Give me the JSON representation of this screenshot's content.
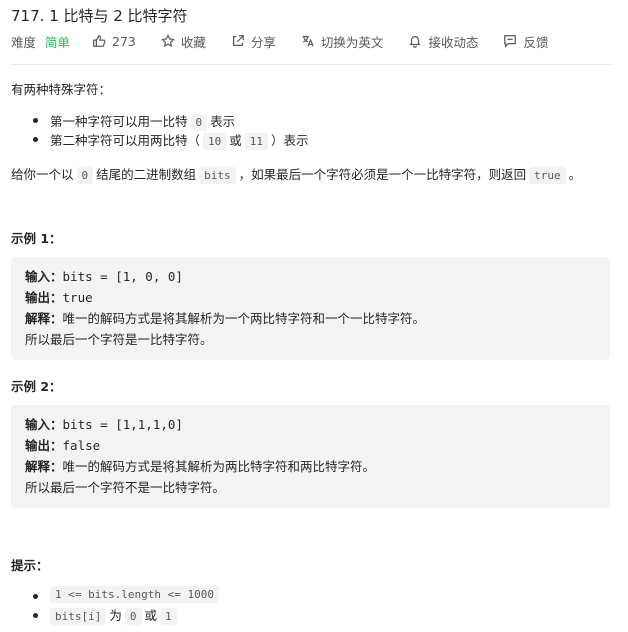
{
  "title": "717. 1 比特与 2 比特字符",
  "toolbar": {
    "difficulty_label": "难度",
    "difficulty_value": "简单",
    "likes": "273",
    "favorite": "收藏",
    "share": "分享",
    "translate": "切换为英文",
    "notify": "接收动态",
    "feedback": "反馈",
    "difficulty_color": "#2db55d"
  },
  "description": {
    "intro": "有两种特殊字符：",
    "bullets": [
      {
        "before": "第一种字符可以用一比特",
        "code": "0",
        "after": "表示"
      },
      {
        "before": "第二种字符可以用两比特（",
        "code1": "10",
        "mid": "或",
        "code2": "11",
        "after": "）表示"
      }
    ],
    "task": {
      "p1": "给你一个以",
      "c1": "0",
      "p2": "结尾的二进制数组",
      "c2": "bits",
      "p3": "，如果最后一个字符必须是一个一比特字符，则返回",
      "c3": "true",
      "p4": "。"
    }
  },
  "examples": [
    {
      "heading": "示例 1：",
      "input_label": "输入：",
      "input_value": "bits = [1, 0, 0]",
      "output_label": "输出：",
      "output_value": "true",
      "explain_label": "解释：",
      "explain_value": "唯一的解码方式是将其解析为一个两比特字符和一个一比特字符。",
      "extra": "所以最后一个字符是一比特字符。"
    },
    {
      "heading": "示例 2：",
      "input_label": "输入：",
      "input_value": "bits = [1,1,1,0]",
      "output_label": "输出：",
      "output_value": "false",
      "explain_label": "解释：",
      "explain_value": "唯一的解码方式是将其解析为两比特字符和两比特字符。",
      "extra": "所以最后一个字符不是一比特字符。"
    }
  ],
  "hints": {
    "heading": "提示：",
    "items": [
      {
        "code": "1 <= bits.length <= 1000"
      },
      {
        "code1": "bits[i]",
        "mid": "为",
        "code2": "0",
        "mid2": "或",
        "code3": "1"
      }
    ]
  }
}
